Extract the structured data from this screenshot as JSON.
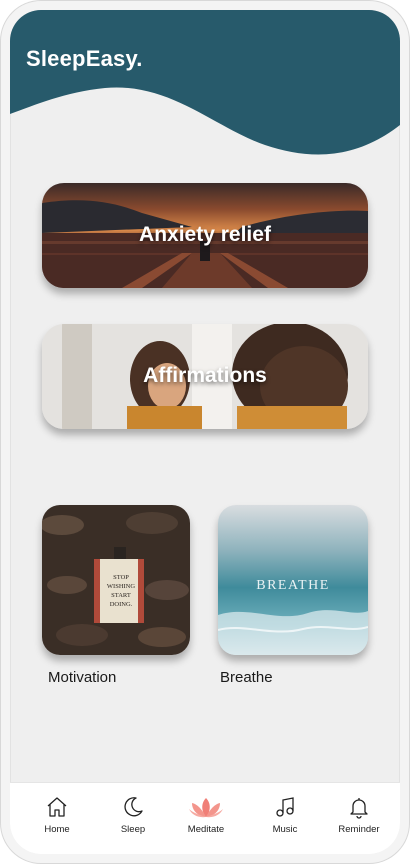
{
  "app": {
    "brand": "SleepEasy."
  },
  "colors": {
    "header": "#275a6b",
    "background": "#efefef",
    "accent": "#f08078"
  },
  "cards": {
    "wide": [
      {
        "title": "Anxiety relief"
      },
      {
        "title": "Affirmations"
      }
    ],
    "square": [
      {
        "label": "Motivation",
        "image_text": [
          "STOP",
          "WISHING",
          "START",
          "DOING."
        ]
      },
      {
        "label": "Breathe",
        "image_text": "BREATHE"
      }
    ]
  },
  "nav": {
    "items": [
      {
        "label": "Home",
        "icon": "home-icon"
      },
      {
        "label": "Sleep",
        "icon": "moon-icon"
      },
      {
        "label": "Meditate",
        "icon": "lotus-icon",
        "active": true
      },
      {
        "label": "Music",
        "icon": "music-note-icon"
      },
      {
        "label": "Reminder",
        "icon": "bell-icon"
      }
    ]
  }
}
